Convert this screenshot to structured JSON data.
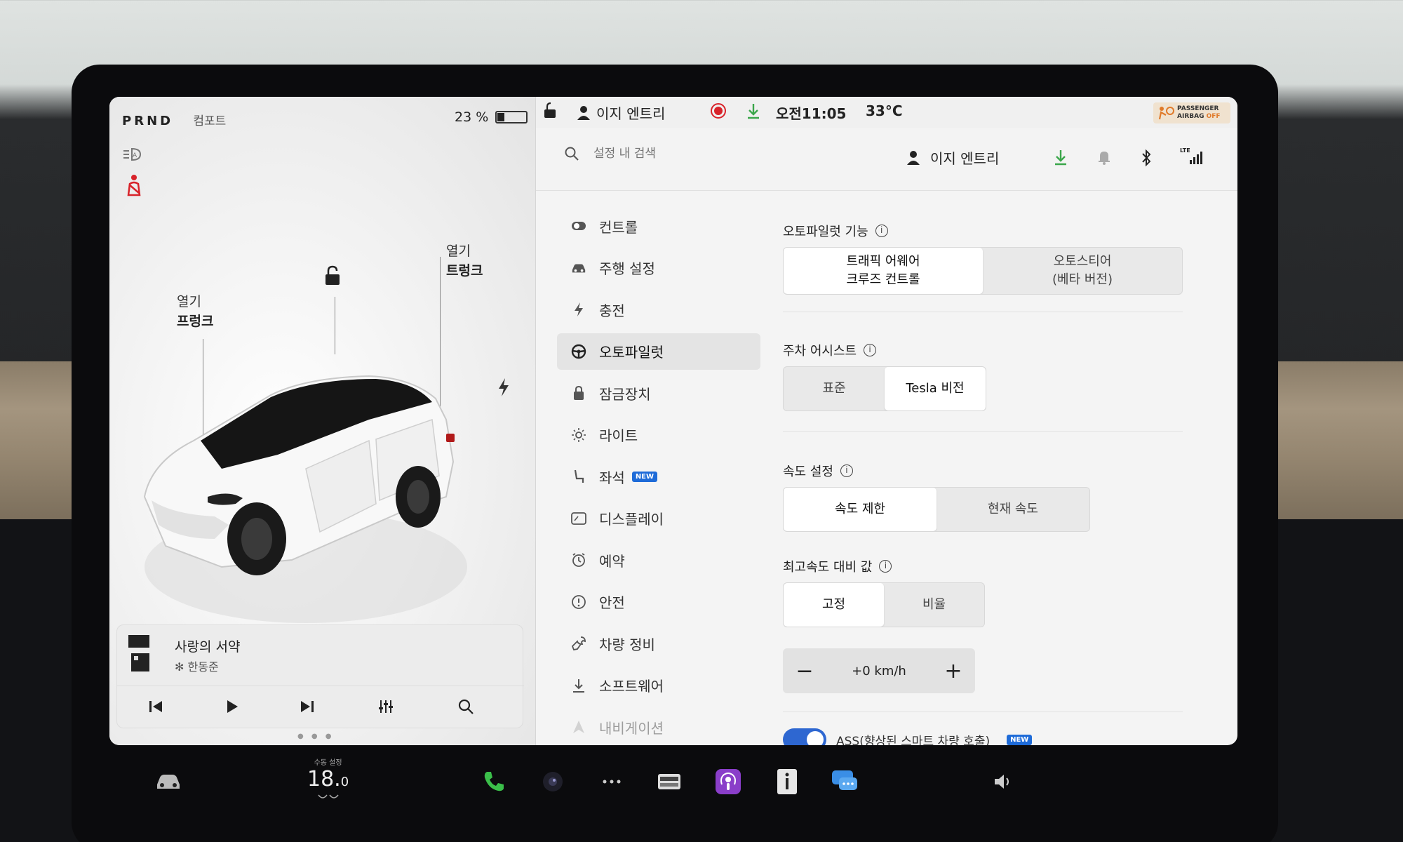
{
  "car_status": {
    "gears": [
      "P",
      "R",
      "N",
      "D"
    ],
    "drive_mode": "컴포트",
    "battery_percent": "23 %",
    "battery_level": 0.23,
    "frunk_label_top": "열기",
    "frunk_label_bottom": "프렁크",
    "trunk_label_top": "열기",
    "trunk_label_bottom": "트렁크"
  },
  "media": {
    "title": "사랑의 서약",
    "artist": "한동준",
    "source_prefix": "✻ "
  },
  "topbar": {
    "profile_name": "이지 엔트리",
    "time": "오전11:05",
    "temperature": "33°C",
    "airbag_line1": "PASSENGER",
    "airbag_line2": "AIRBAG",
    "airbag_state": "OFF"
  },
  "header": {
    "search_placeholder": "설정 내 검색",
    "profile_name": "이지 엔트리",
    "network_label": "LTE"
  },
  "sidebar": {
    "items": [
      {
        "label": "컨트롤",
        "icon": "toggle-icon"
      },
      {
        "label": "주행 설정",
        "icon": "car-icon"
      },
      {
        "label": "충전",
        "icon": "bolt-icon"
      },
      {
        "label": "오토파일럿",
        "icon": "steering-wheel-icon"
      },
      {
        "label": "잠금장치",
        "icon": "lock-icon"
      },
      {
        "label": "라이트",
        "icon": "light-icon"
      },
      {
        "label": "좌석",
        "icon": "seat-icon",
        "badge": "NEW"
      },
      {
        "label": "디스플레이",
        "icon": "display-icon"
      },
      {
        "label": "예약",
        "icon": "alarm-clock-icon"
      },
      {
        "label": "안전",
        "icon": "alert-circle-icon"
      },
      {
        "label": "차량 정비",
        "icon": "wrench-icon"
      },
      {
        "label": "소프트웨어",
        "icon": "download-icon"
      },
      {
        "label": "내비게이션",
        "icon": "navigation-icon"
      }
    ],
    "active_index": 3
  },
  "autopilot": {
    "features_title": "오토파일럿 기능",
    "features_opt1_line1": "트래픽 어웨어",
    "features_opt1_line2": "크루즈 컨트롤",
    "features_opt2_line1": "오토스티어",
    "features_opt2_line2": "(베타 버전)",
    "park_title": "주차 어시스트",
    "park_opt1": "표준",
    "park_opt2": "Tesla 비전",
    "speed_title": "속도 설정",
    "speed_opt1": "속도 제한",
    "speed_opt2": "현재 속도",
    "offset_title": "최고속도 대비 값",
    "offset_opt1": "고정",
    "offset_opt2": "비율",
    "offset_value": "+0 km/h",
    "minus": "−",
    "plus": "+",
    "ass_label": "ASS(향상된 스마트 차량 호출)",
    "ass_badge": "NEW",
    "ass_enabled": true
  },
  "dock": {
    "temp_label": "수동 설정",
    "temp_value": "18.",
    "temp_decimal": "0"
  },
  "colors": {
    "accent_blue": "#1e6bd8",
    "download_green": "#3aa64a",
    "record_red": "#d8232a",
    "seatbelt_red": "#d8232a",
    "phone_green": "#3bbf4a",
    "podcast_purple": "#8a3ec9",
    "messages_blue": "#3a8ee6"
  }
}
